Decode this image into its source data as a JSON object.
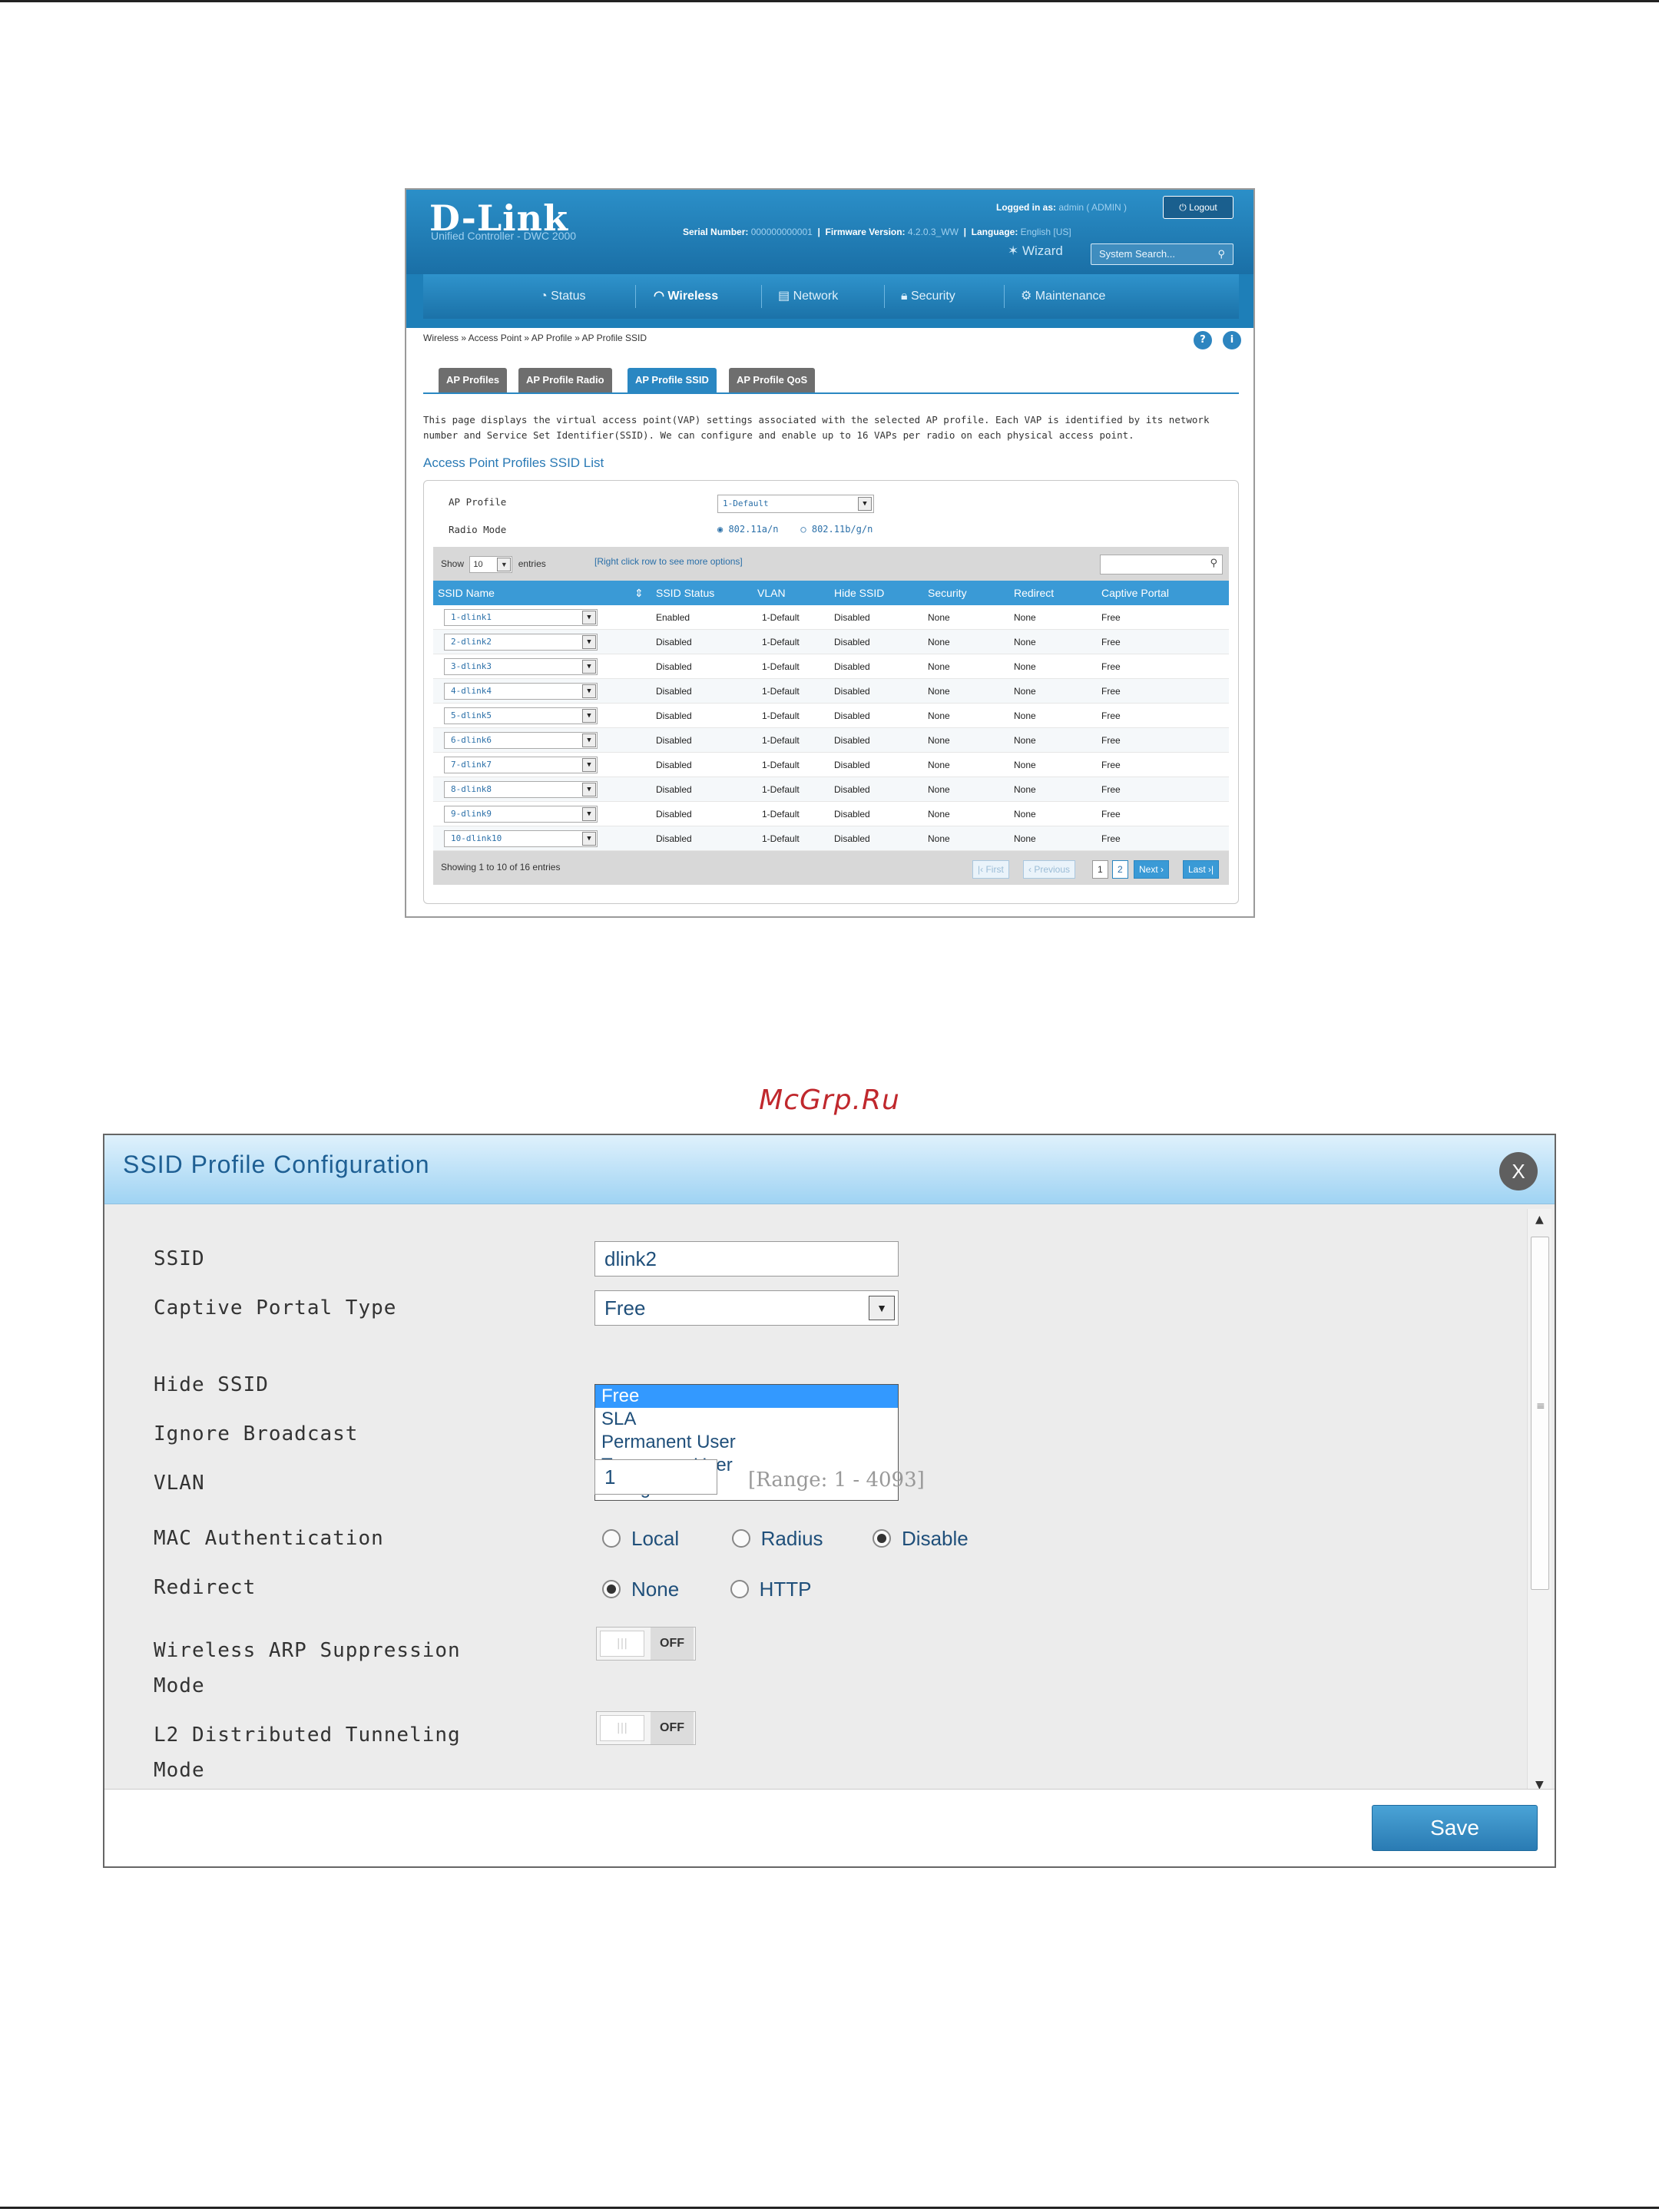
{
  "screenshot1": {
    "brand": {
      "logo": "D-Link",
      "product": "Unified Controller - DWC 2000"
    },
    "header": {
      "serial_label": "Serial Number:",
      "serial_value": "000000000001",
      "firmware_label": "Firmware Version:",
      "firmware_value": "4.2.0.3_WW",
      "logged_label": "Logged in as:",
      "logged_value": "admin ( ADMIN )",
      "language_label": "Language:",
      "language_value": "English [US]",
      "logout": "Logout",
      "wizard": "Wizard",
      "search_placeholder": "System Search..."
    },
    "nav": [
      "Status",
      "Wireless",
      "Network",
      "Security",
      "Maintenance"
    ],
    "breadcrumb": "Wireless  »  Access Point  »  AP Profile  »  AP Profile SSID",
    "tabs": [
      "AP Profiles",
      "AP Profile Radio",
      "AP Profile SSID",
      "AP Profile QoS"
    ],
    "description": "This page displays the virtual access point(VAP) settings associated with the selected AP profile. Each VAP is identified by its network number and Service Set Identifier(SSID). We can configure and enable up to 16 VAPs per radio on each physical access point.",
    "section_title": "Access Point Profiles SSID List",
    "form": {
      "ap_profile_label": "AP Profile",
      "ap_profile_value": "1-Default",
      "radio_mode_label": "Radio Mode",
      "radio_a": "802.11a/n",
      "radio_b": "802.11b/g/n"
    },
    "table": {
      "show_label": "Show",
      "show_value": "10",
      "entries_label": "entries",
      "hint": "[Right click row to see more options]",
      "columns": [
        "SSID Name",
        "SSID Status",
        "VLAN",
        "Hide SSID",
        "Security",
        "Redirect",
        "Captive Portal"
      ],
      "rows": [
        [
          "1-dlink1",
          "Enabled",
          "1-Default",
          "Disabled",
          "None",
          "None",
          "Free"
        ],
        [
          "2-dlink2",
          "Disabled",
          "1-Default",
          "Disabled",
          "None",
          "None",
          "Free"
        ],
        [
          "3-dlink3",
          "Disabled",
          "1-Default",
          "Disabled",
          "None",
          "None",
          "Free"
        ],
        [
          "4-dlink4",
          "Disabled",
          "1-Default",
          "Disabled",
          "None",
          "None",
          "Free"
        ],
        [
          "5-dlink5",
          "Disabled",
          "1-Default",
          "Disabled",
          "None",
          "None",
          "Free"
        ],
        [
          "6-dlink6",
          "Disabled",
          "1-Default",
          "Disabled",
          "None",
          "None",
          "Free"
        ],
        [
          "7-dlink7",
          "Disabled",
          "1-Default",
          "Disabled",
          "None",
          "None",
          "Free"
        ],
        [
          "8-dlink8",
          "Disabled",
          "1-Default",
          "Disabled",
          "None",
          "None",
          "Free"
        ],
        [
          "9-dlink9",
          "Disabled",
          "1-Default",
          "Disabled",
          "None",
          "None",
          "Free"
        ],
        [
          "10-dlink10",
          "Disabled",
          "1-Default",
          "Disabled",
          "None",
          "None",
          "Free"
        ]
      ],
      "showing": "Showing 1 to 10 of 16 entries",
      "pagination": {
        "first": "First",
        "previous": "Previous",
        "p1": "1",
        "p2": "2",
        "next": "Next",
        "last": "Last"
      }
    }
  },
  "watermark": "McGrp.Ru",
  "modal": {
    "title": "SSID Profile Configuration",
    "close": "X",
    "ssid_label": "SSID",
    "ssid_value": "dlink2",
    "captive_label": "Captive Portal Type",
    "captive_value": "Free",
    "captive_options": [
      "Free",
      "SLA",
      "Permanent User",
      "Temporary User",
      "Billing User"
    ],
    "hide_ssid_label": "Hide SSID",
    "ignore_broadcast_label": "Ignore Broadcast",
    "vlan_label": "VLAN",
    "vlan_value": "1",
    "vlan_range": "[Range: 1 - 4093]",
    "mac_auth_label": "MAC Authentication",
    "mac_auth_options": [
      "Local",
      "Radius",
      "Disable"
    ],
    "redirect_label": "Redirect",
    "redirect_options": [
      "None",
      "HTTP"
    ],
    "arp_label_1": "Wireless ARP Suppression",
    "arp_label_2": "Mode",
    "l2_label_1": "L2 Distributed Tunneling",
    "l2_label_2": "Mode",
    "toggle_off": "OFF",
    "save": "Save"
  }
}
